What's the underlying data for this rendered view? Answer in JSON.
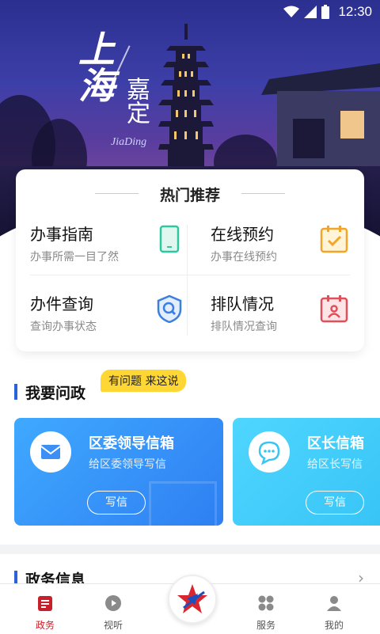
{
  "status_bar": {
    "time": "12:30"
  },
  "hero": {
    "city": "上海",
    "district": "嘉定",
    "district_en": "JiaDing"
  },
  "hot": {
    "title": "热门推荐",
    "items": [
      {
        "title": "办事指南",
        "subtitle": "办事所需一目了然",
        "icon": "phone-icon",
        "color": "#2dc8a0"
      },
      {
        "title": "在线预约",
        "subtitle": "办事在线预约",
        "icon": "calendar-check-icon",
        "color": "#f3a52a"
      },
      {
        "title": "办件查询",
        "subtitle": "查询办事状态",
        "icon": "shield-search-icon",
        "color": "#3b7fe0"
      },
      {
        "title": "排队情况",
        "subtitle": "排队情况查询",
        "icon": "calendar-person-icon",
        "color": "#e0505a"
      }
    ]
  },
  "ask": {
    "title": "我要问政",
    "tag": "有问题 来这说",
    "cards": [
      {
        "title": "区委领导信箱",
        "subtitle": "给区委领导写信",
        "button": "写信",
        "icon": "envelope-icon"
      },
      {
        "title": "区长信箱",
        "subtitle": "给区长写信",
        "button": "写信",
        "icon": "chat-bubble-icon"
      }
    ]
  },
  "info": {
    "title": "政务信息"
  },
  "tabs": [
    {
      "label": "政务",
      "icon": "gov-icon",
      "active": true
    },
    {
      "label": "视听",
      "icon": "play-icon",
      "active": false
    },
    {
      "label": "服务",
      "icon": "grid-icon",
      "active": false
    },
    {
      "label": "我的",
      "icon": "user-icon",
      "active": false
    }
  ],
  "colors": {
    "accent": "#c8202a",
    "section_bar": "#2a63d8",
    "tag_bg": "#ffd735"
  }
}
